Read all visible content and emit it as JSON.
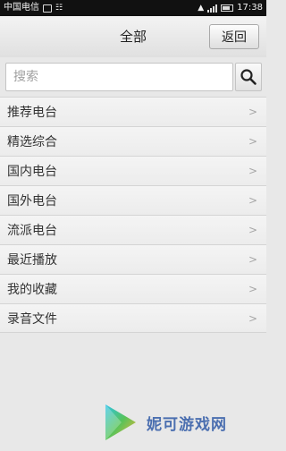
{
  "status_bar": {
    "carrier": "中国电信",
    "time": "17:38"
  },
  "header": {
    "title": "全部",
    "back_label": "返回"
  },
  "search": {
    "placeholder": "搜索",
    "value": ""
  },
  "list": {
    "chevron": ">",
    "items": [
      {
        "label": "推荐电台"
      },
      {
        "label": "精选综合"
      },
      {
        "label": "国内电台"
      },
      {
        "label": "国外电台"
      },
      {
        "label": "流派电台"
      },
      {
        "label": "最近播放"
      },
      {
        "label": "我的收藏"
      },
      {
        "label": "录音文件"
      }
    ]
  },
  "watermark": {
    "text": "妮可游戏网",
    "icon": "play-triangle-logo"
  },
  "colors": {
    "background": "#e8e8e8",
    "status_bar": "#111111",
    "watermark": "#4b6fb0"
  }
}
